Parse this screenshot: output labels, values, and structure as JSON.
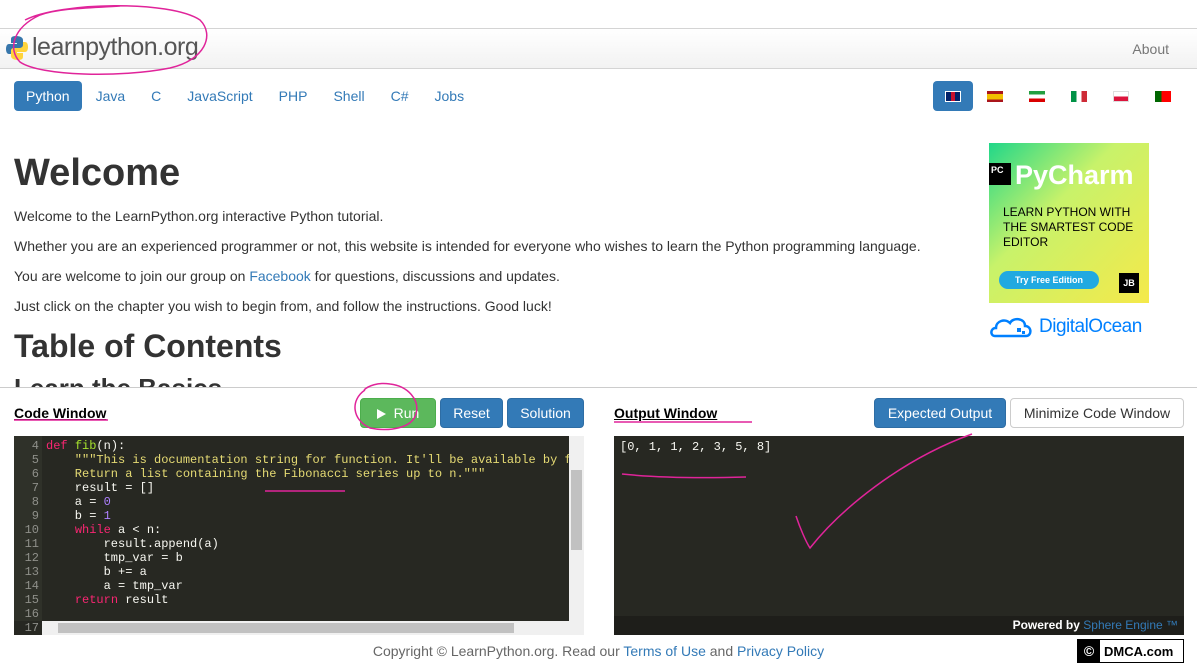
{
  "brand": {
    "name": "learnpython.org"
  },
  "nav": {
    "about": "About"
  },
  "languages": [
    "Python",
    "Java",
    "C",
    "JavaScript",
    "PHP",
    "Shell",
    "C#",
    "Jobs"
  ],
  "main": {
    "title": "Welcome",
    "p1": "Welcome to the LearnPython.org interactive Python tutorial.",
    "p2": "Whether you are an experienced programmer or not, this website is intended for everyone who wishes to learn the Python programming language.",
    "p3_before": "You are welcome to join our group on ",
    "p3_link": "Facebook",
    "p3_after": " for questions, discussions and updates.",
    "p4": "Just click on the chapter you wish to begin from, and follow the instructions. Good luck!",
    "toc": "Table of Contents",
    "basics": "Learn the Basics"
  },
  "ad": {
    "badge": "PC",
    "name": "PyCharm",
    "text": "LEARN PYTHON WITH THE SMARTEST CODE EDITOR",
    "button": "Try Free Edition",
    "jb": "JB"
  },
  "sponsor": {
    "name": "DigitalOcean"
  },
  "code_window": {
    "label": "Code Window",
    "run": "Run",
    "reset": "Reset",
    "solution": "Solution"
  },
  "output_window": {
    "label": "Output Window",
    "expected": "Expected Output",
    "minimize": "Minimize Code Window",
    "output": "[0, 1, 1, 2, 3, 5, 8]",
    "powered_by": "Powered by ",
    "engine": "Sphere Engine ™"
  },
  "code_lines": [
    {
      "n": "4",
      "t": "def fib(n):"
    },
    {
      "n": "5",
      "t": "    \"\"\"This is documentation string for function. It'll be available by fib"
    },
    {
      "n": "6",
      "t": "    Return a list containing the Fibonacci series up to n.\"\"\""
    },
    {
      "n": "7",
      "t": "    result = []"
    },
    {
      "n": "8",
      "t": "    a = 0"
    },
    {
      "n": "9",
      "t": "    b = 1"
    },
    {
      "n": "10",
      "t": "    while a < n:"
    },
    {
      "n": "11",
      "t": "        result.append(a)"
    },
    {
      "n": "12",
      "t": "        tmp_var = b"
    },
    {
      "n": "13",
      "t": "        b += a"
    },
    {
      "n": "14",
      "t": "        a = tmp_var"
    },
    {
      "n": "15",
      "t": "    return result"
    },
    {
      "n": "16",
      "t": ""
    },
    {
      "n": "17",
      "t": ""
    }
  ],
  "footer": {
    "copyright": "Copyright © LearnPython.org. Read our ",
    "terms": "Terms of Use",
    "and": " and ",
    "privacy": "Privacy Policy"
  },
  "dmca": {
    "c": "©",
    "text": "DMCA.com"
  },
  "colors": {
    "primary": "#337ab7",
    "success": "#5cb85c",
    "editor_bg": "#272822",
    "annotation": "#e0249a"
  }
}
